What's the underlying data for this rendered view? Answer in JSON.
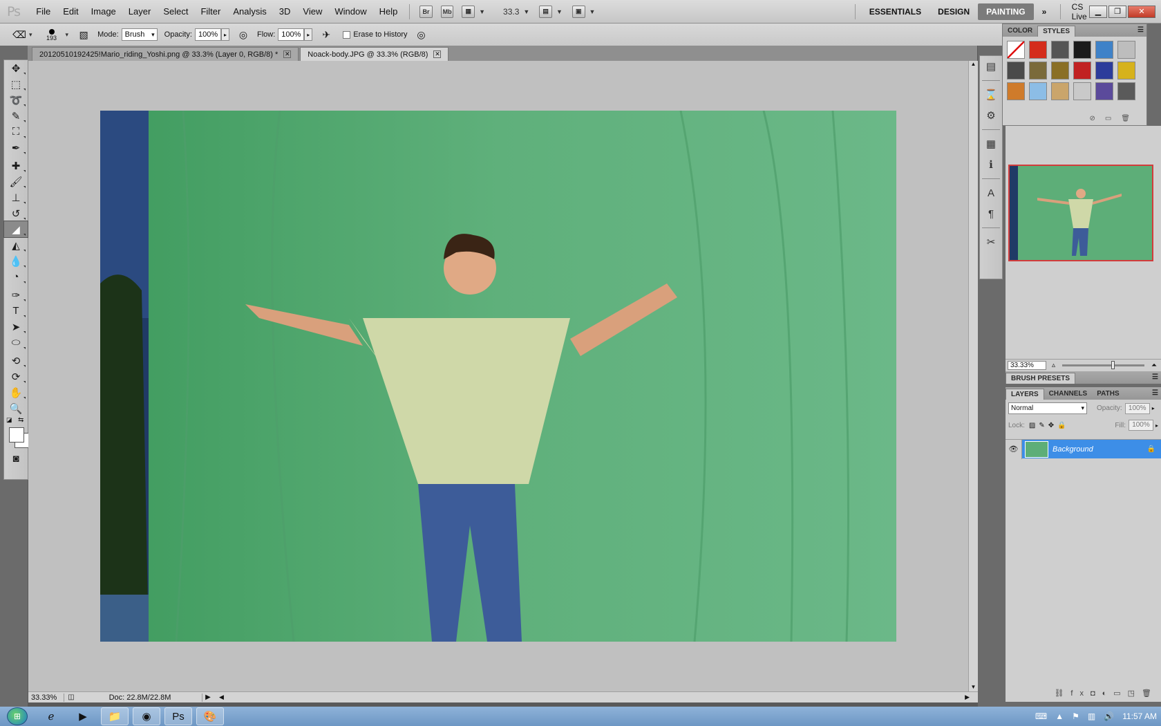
{
  "app": {
    "logo": "Ps"
  },
  "menu": [
    "File",
    "Edit",
    "Image",
    "Layer",
    "Select",
    "Filter",
    "Analysis",
    "3D",
    "View",
    "Window",
    "Help"
  ],
  "appbar": {
    "bridge": "Br",
    "minibridge": "Mb",
    "zoom_value": "33.3",
    "workspaces": [
      "ESSENTIALS",
      "DESIGN",
      "PAINTING"
    ],
    "active_workspace": "PAINTING",
    "cs_live": "CS Live"
  },
  "options": {
    "brush_size": "193",
    "mode_label": "Mode:",
    "mode_value": "Brush",
    "opacity_label": "Opacity:",
    "opacity_value": "100%",
    "flow_label": "Flow:",
    "flow_value": "100%",
    "erase_history_label": "Erase to History"
  },
  "document_tabs": [
    {
      "title": "20120510192425!Mario_riding_Yoshi.png @ 33.3% (Layer 0, RGB/8) *",
      "active": false
    },
    {
      "title": "Noack-body.JPG @ 33.3% (RGB/8)",
      "active": true
    }
  ],
  "status": {
    "zoom": "33.33%",
    "doc": "Doc: 22.8M/22.8M"
  },
  "styles_panel": {
    "tabs": [
      "COLOR",
      "STYLES"
    ],
    "active_tab": "STYLES",
    "swatch_colors": [
      "#ffffff",
      "#d42c1b",
      "#555555",
      "#1b1b1b",
      "#3f82c8",
      "#bdbdbd",
      "#4a4a4a",
      "#7a6a3a",
      "#8a6f25",
      "#c12121",
      "#2c3c9b",
      "#d6b21c",
      "#cf7b2b",
      "#8cbde6",
      "#caa56b",
      "#c9c9c9",
      "#5b4a9b",
      "#5a5a5a"
    ]
  },
  "navigator": {
    "zoom": "33.33%"
  },
  "brush_presets": {
    "title": "BRUSH PRESETS"
  },
  "layers_panel": {
    "tabs": [
      "LAYERS",
      "CHANNELS",
      "PATHS"
    ],
    "active_tab": "LAYERS",
    "blend_mode": "Normal",
    "opacity_label": "Opacity:",
    "opacity_value": "100%",
    "lock_label": "Lock:",
    "fill_label": "Fill:",
    "fill_value": "100%",
    "layers": [
      {
        "name": "Background",
        "locked": true
      }
    ]
  },
  "taskbar": {
    "clock": "11:57 AM"
  }
}
